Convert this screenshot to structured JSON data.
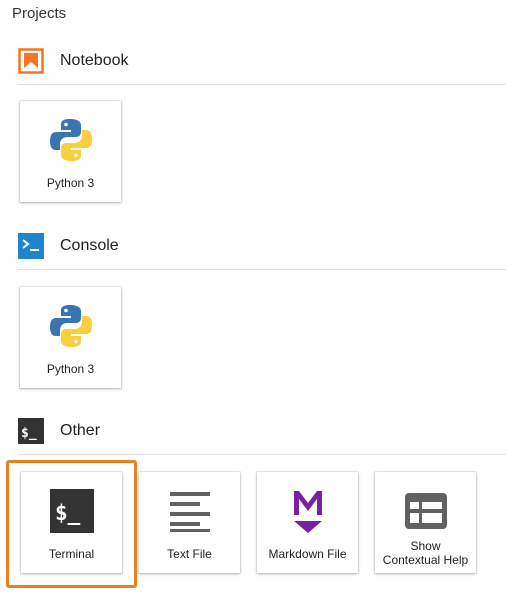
{
  "breadcrumb": "Projects",
  "sections": [
    {
      "label": "Notebook",
      "icon": "notebook-icon",
      "items": [
        {
          "label": "Python 3",
          "icon": "python-logo-icon"
        }
      ]
    },
    {
      "label": "Console",
      "icon": "console-icon",
      "items": [
        {
          "label": "Python 3",
          "icon": "python-logo-icon"
        }
      ]
    },
    {
      "label": "Other",
      "icon": "terminal-icon",
      "items": [
        {
          "label": "Terminal",
          "icon": "terminal-icon"
        },
        {
          "label": "Text File",
          "icon": "text-file-icon"
        },
        {
          "label": "Markdown File",
          "icon": "markdown-icon"
        },
        {
          "label_line1": "Show",
          "label_line2": "Contextual Help",
          "icon": "contextual-help-icon"
        }
      ]
    }
  ],
  "colors": {
    "notebook_accent": "#f37626",
    "console_accent": "#1f84cc",
    "terminal_bg": "#333333",
    "markdown_accent": "#7b1fa2",
    "icon_gray": "#616161",
    "highlight_border": "#e8821e"
  }
}
